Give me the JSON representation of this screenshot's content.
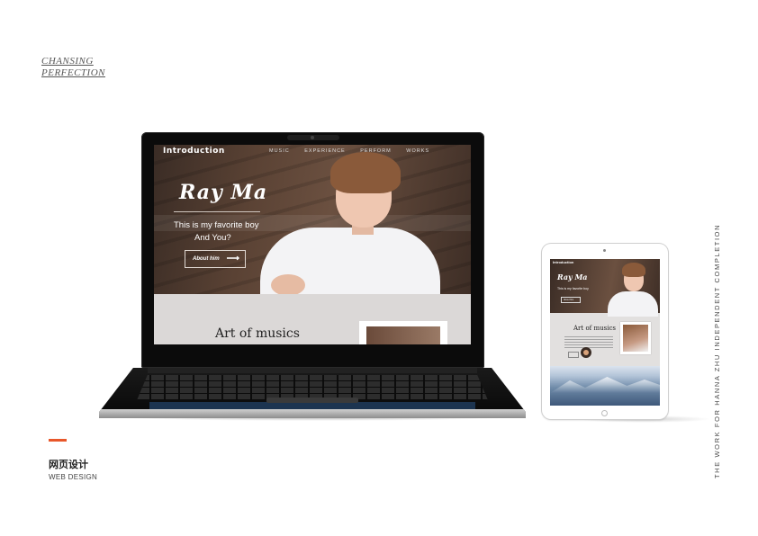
{
  "brand": {
    "line1": "CHANSING",
    "line2": "PERFECTION"
  },
  "caption": {
    "zh": "网页设计",
    "en": "WEB DESIGN"
  },
  "vertical_credit": "THE WORK FOR HANNA ZHU INDEPENDENT COMPLETION",
  "accent_color": "#e8572a",
  "laptop_site": {
    "logo": "Introduction",
    "nav": [
      "MUSIC",
      "EXPERIENCE",
      "PERFORM",
      "WORKS"
    ],
    "hero_title": "Ray Ma",
    "hero_sub1": "This is my favorite boy",
    "hero_sub2": "And You?",
    "hero_button": "About him",
    "section_title": "Art  of  musics"
  },
  "tablet_site": {
    "logo": "Introduction",
    "hero_title": "Ray Ma",
    "hero_sub": "This is my favorite boy",
    "hero_button": "About him",
    "section_title": "Art  of  musics"
  }
}
